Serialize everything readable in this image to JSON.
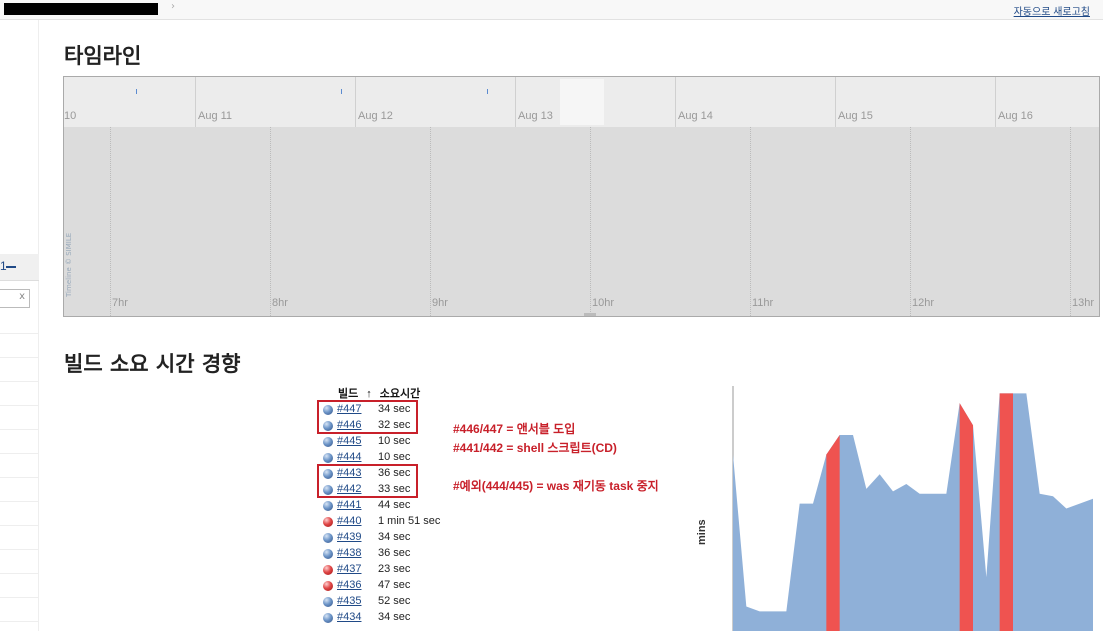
{
  "topbar": {
    "auto_refresh": "자동으로 새로고침",
    "arrow": "›"
  },
  "sidebar": {
    "head_num": "1",
    "search_clear": "x"
  },
  "timeline": {
    "title": "타임라인",
    "day_labels": [
      "10",
      "Aug 11",
      "Aug 12",
      "Aug 13",
      "Aug 14",
      "Aug 15",
      "Aug 16"
    ],
    "hour_labels": [
      "7hr",
      "8hr",
      "9hr",
      "10hr",
      "11hr",
      "12hr",
      "13hr"
    ],
    "credit": "Timeline © SIMILE"
  },
  "trend": {
    "title": "빌드 소요 시간 경향",
    "col_build": "빌드",
    "sort_arrow": "↑",
    "col_duration": "소요시간",
    "builds": [
      {
        "num": "#447",
        "duration": "34 sec",
        "status": "success"
      },
      {
        "num": "#446",
        "duration": "32 sec",
        "status": "success"
      },
      {
        "num": "#445",
        "duration": "10 sec",
        "status": "success"
      },
      {
        "num": "#444",
        "duration": "10 sec",
        "status": "success"
      },
      {
        "num": "#443",
        "duration": "36 sec",
        "status": "success"
      },
      {
        "num": "#442",
        "duration": "33 sec",
        "status": "success"
      },
      {
        "num": "#441",
        "duration": "44 sec",
        "status": "success"
      },
      {
        "num": "#440",
        "duration": "1 min 51 sec",
        "status": "failed"
      },
      {
        "num": "#439",
        "duration": "34 sec",
        "status": "success"
      },
      {
        "num": "#438",
        "duration": "36 sec",
        "status": "success"
      },
      {
        "num": "#437",
        "duration": "23 sec",
        "status": "failed"
      },
      {
        "num": "#436",
        "duration": "47 sec",
        "status": "failed"
      },
      {
        "num": "#435",
        "duration": "52 sec",
        "status": "success"
      },
      {
        "num": "#434",
        "duration": "34 sec",
        "status": "success"
      }
    ],
    "notes": [
      "#446/447 = 앤서블 도입",
      "#441/442 = shell 스크립트(CD)",
      "#예외(444/445) = was 재기동 task 중지"
    ],
    "colors": {
      "success": "#8fb0d8",
      "failed": "#ef5350",
      "annotation": "#c8202a"
    }
  },
  "chart_data": {
    "type": "area",
    "ylabel": "mins",
    "values": [
      0.72,
      0.1,
      0.08,
      0.08,
      0.08,
      0.52,
      0.52,
      0.72,
      0.8,
      0.8,
      0.58,
      0.64,
      0.57,
      0.6,
      0.56,
      0.56,
      0.56,
      0.93,
      0.84,
      0.22,
      0.97,
      0.97,
      0.97,
      0.56,
      0.55,
      0.5,
      0.52,
      0.54
    ],
    "failed_bands": [
      [
        7,
        8
      ],
      [
        17,
        18
      ],
      [
        20,
        21
      ]
    ],
    "ylim": [
      0,
      1
    ]
  }
}
